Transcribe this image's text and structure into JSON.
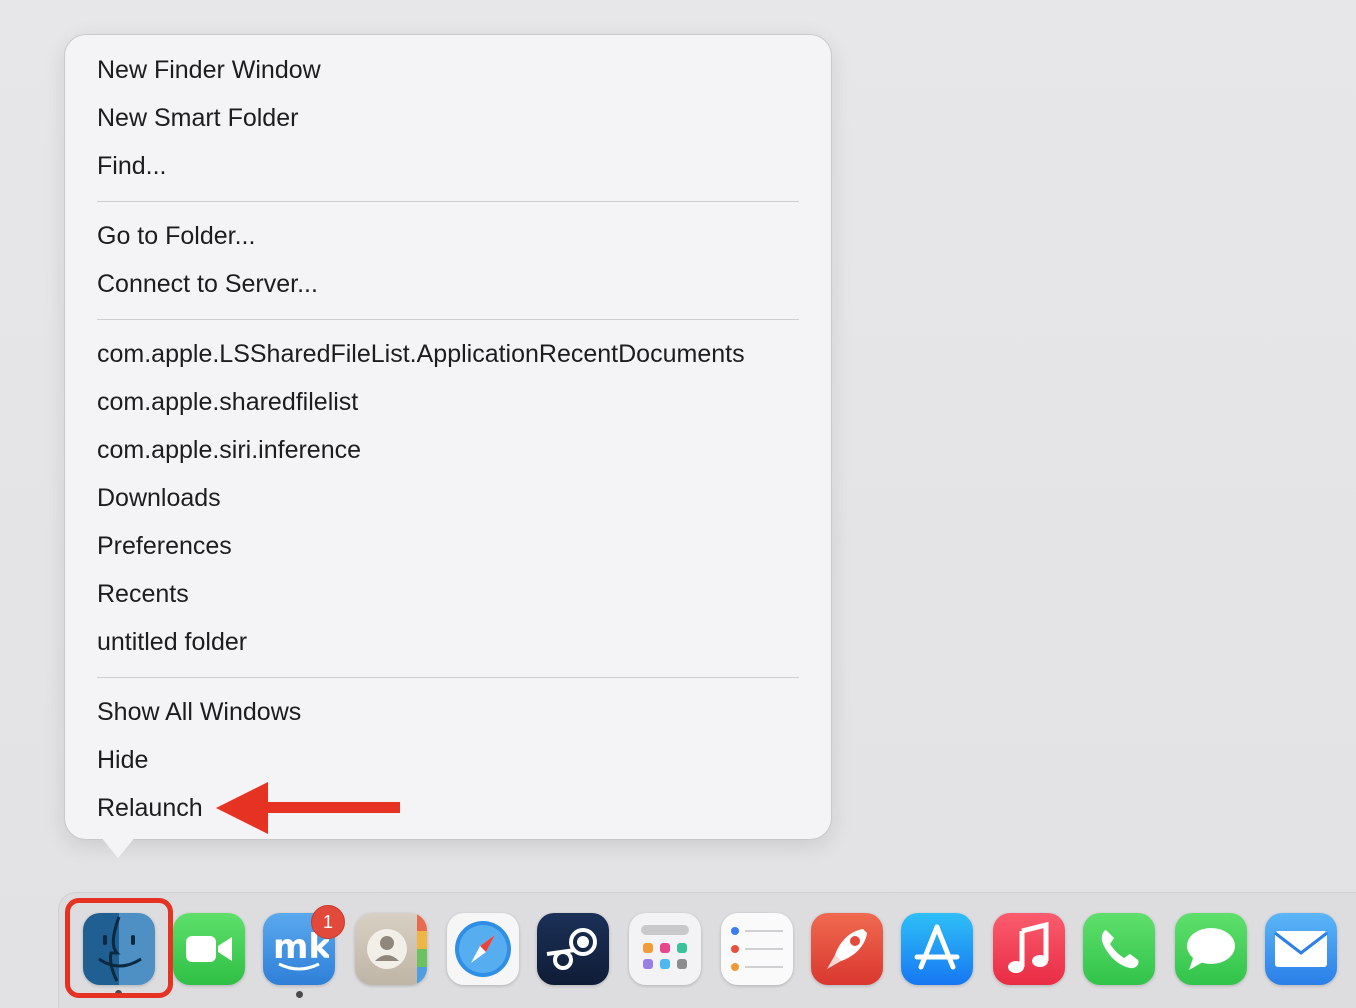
{
  "context_menu": {
    "groups": [
      {
        "items": [
          {
            "label": "New Finder Window"
          },
          {
            "label": "New Smart Folder"
          },
          {
            "label": "Find..."
          }
        ]
      },
      {
        "items": [
          {
            "label": "Go to Folder..."
          },
          {
            "label": "Connect to Server..."
          }
        ]
      },
      {
        "items": [
          {
            "label": "com.apple.LSSharedFileList.ApplicationRecentDocuments"
          },
          {
            "label": "com.apple.sharedfilelist"
          },
          {
            "label": "com.apple.siri.inference"
          },
          {
            "label": "Downloads"
          },
          {
            "label": "Preferences"
          },
          {
            "label": "Recents"
          },
          {
            "label": "untitled folder"
          }
        ]
      },
      {
        "items": [
          {
            "label": "Show All Windows"
          },
          {
            "label": "Hide"
          },
          {
            "label": "Relaunch"
          }
        ]
      }
    ]
  },
  "annotation": {
    "color": "#e53222",
    "target": "Relaunch"
  },
  "dock": {
    "apps": [
      {
        "name": "finder-icon",
        "running": true,
        "highlighted": true
      },
      {
        "name": "facetime-icon"
      },
      {
        "name": "mk-app-icon",
        "badge": "1",
        "running": true
      },
      {
        "name": "contacts-icon"
      },
      {
        "name": "safari-icon"
      },
      {
        "name": "steam-icon"
      },
      {
        "name": "launchpad-icon"
      },
      {
        "name": "reminders-icon"
      },
      {
        "name": "rocket-app-icon"
      },
      {
        "name": "app-store-icon"
      },
      {
        "name": "music-icon"
      },
      {
        "name": "phone-icon"
      },
      {
        "name": "messages-icon"
      },
      {
        "name": "mail-icon"
      }
    ]
  }
}
